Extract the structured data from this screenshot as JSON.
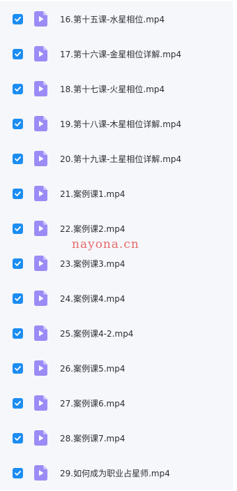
{
  "colors": {
    "list_background": "#f6f7fb",
    "checkbox_checked": "#1c8df2",
    "video_icon": "#9a8cf6",
    "watermark": "#e86a6a"
  },
  "files": [
    {
      "name": "16.第十五课-水星相位.mp4",
      "checked": true,
      "icon": "video-file-icon"
    },
    {
      "name": "17.第十六课-金星相位详解.mp4",
      "checked": true,
      "icon": "video-file-icon"
    },
    {
      "name": "18.第十七课-火星相位.mp4",
      "checked": true,
      "icon": "video-file-icon"
    },
    {
      "name": "19.第十八课-木星相位详解.mp4",
      "checked": true,
      "icon": "video-file-icon"
    },
    {
      "name": "20.第十九课-土星相位详解.mp4",
      "checked": true,
      "icon": "video-file-icon"
    },
    {
      "name": "21.案例课1.mp4",
      "checked": true,
      "icon": "video-file-icon"
    },
    {
      "name": "22.案例课2.mp4",
      "checked": true,
      "icon": "video-file-icon"
    },
    {
      "name": "23.案例课3.mp4",
      "checked": true,
      "icon": "video-file-icon"
    },
    {
      "name": "24.案例课4.mp4",
      "checked": true,
      "icon": "video-file-icon"
    },
    {
      "name": "25.案例课4-2.mp4",
      "checked": true,
      "icon": "video-file-icon"
    },
    {
      "name": "26.案例课5.mp4",
      "checked": true,
      "icon": "video-file-icon"
    },
    {
      "name": "27.案例课6.mp4",
      "checked": true,
      "icon": "video-file-icon"
    },
    {
      "name": "28.案例课7.mp4",
      "checked": true,
      "icon": "video-file-icon"
    },
    {
      "name": "29.如何成为职业占星师.mp4",
      "checked": true,
      "icon": "video-file-icon"
    }
  ],
  "watermark": "nayona.cn"
}
